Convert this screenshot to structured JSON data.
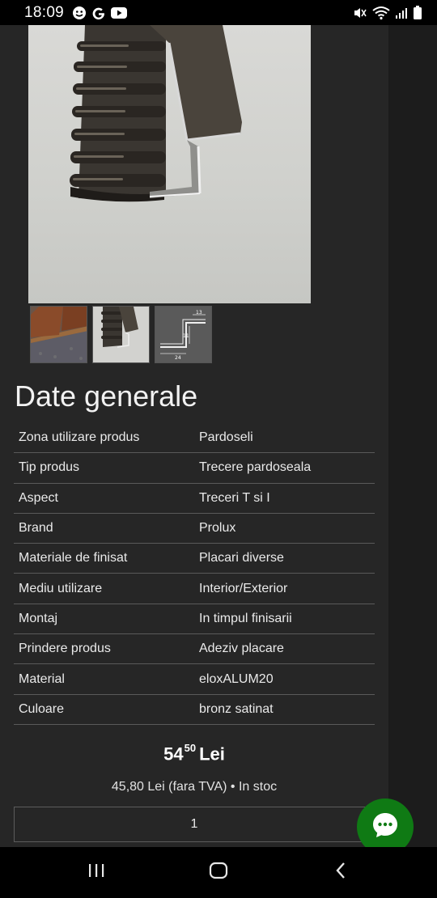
{
  "status_bar": {
    "time": "18:09",
    "left_icons": [
      "face-icon",
      "google-icon",
      "youtube-icon"
    ],
    "right_icons": [
      "mute-icon",
      "wifi-icon",
      "signal-icon",
      "battery-icon"
    ]
  },
  "gallery": {
    "main_image": "aluminium-profile-photo",
    "thumbnails": [
      "floor-transition-photo",
      "aluminium-profile-photo",
      "profile-dimension-drawing"
    ],
    "drawing_dimensions": [
      "13",
      "11",
      "24"
    ]
  },
  "section_title": "Date generale",
  "specs": [
    {
      "key": "Zona utilizare produs",
      "value": "Pardoseli"
    },
    {
      "key": "Tip produs",
      "value": "Trecere pardoseala"
    },
    {
      "key": "Aspect",
      "value": "Treceri T si I"
    },
    {
      "key": "Brand",
      "value": "Prolux"
    },
    {
      "key": "Materiale de finisat",
      "value": "Placari diverse"
    },
    {
      "key": "Mediu utilizare",
      "value": "Interior/Exterior"
    },
    {
      "key": "Montaj",
      "value": "In timpul finisarii"
    },
    {
      "key": "Prindere produs",
      "value": "Adeziv placare"
    },
    {
      "key": "Material",
      "value": "eloxALUM20"
    },
    {
      "key": "Culoare",
      "value": "bronz satinat"
    }
  ],
  "price": {
    "integer": "54",
    "decimals": "50",
    "currency": "Lei",
    "subline": "45,80 Lei (fara TVA) • In stoc"
  },
  "quantity": "1",
  "colors": {
    "page_bg": "#262626",
    "chat_button": "#0f7a14"
  }
}
